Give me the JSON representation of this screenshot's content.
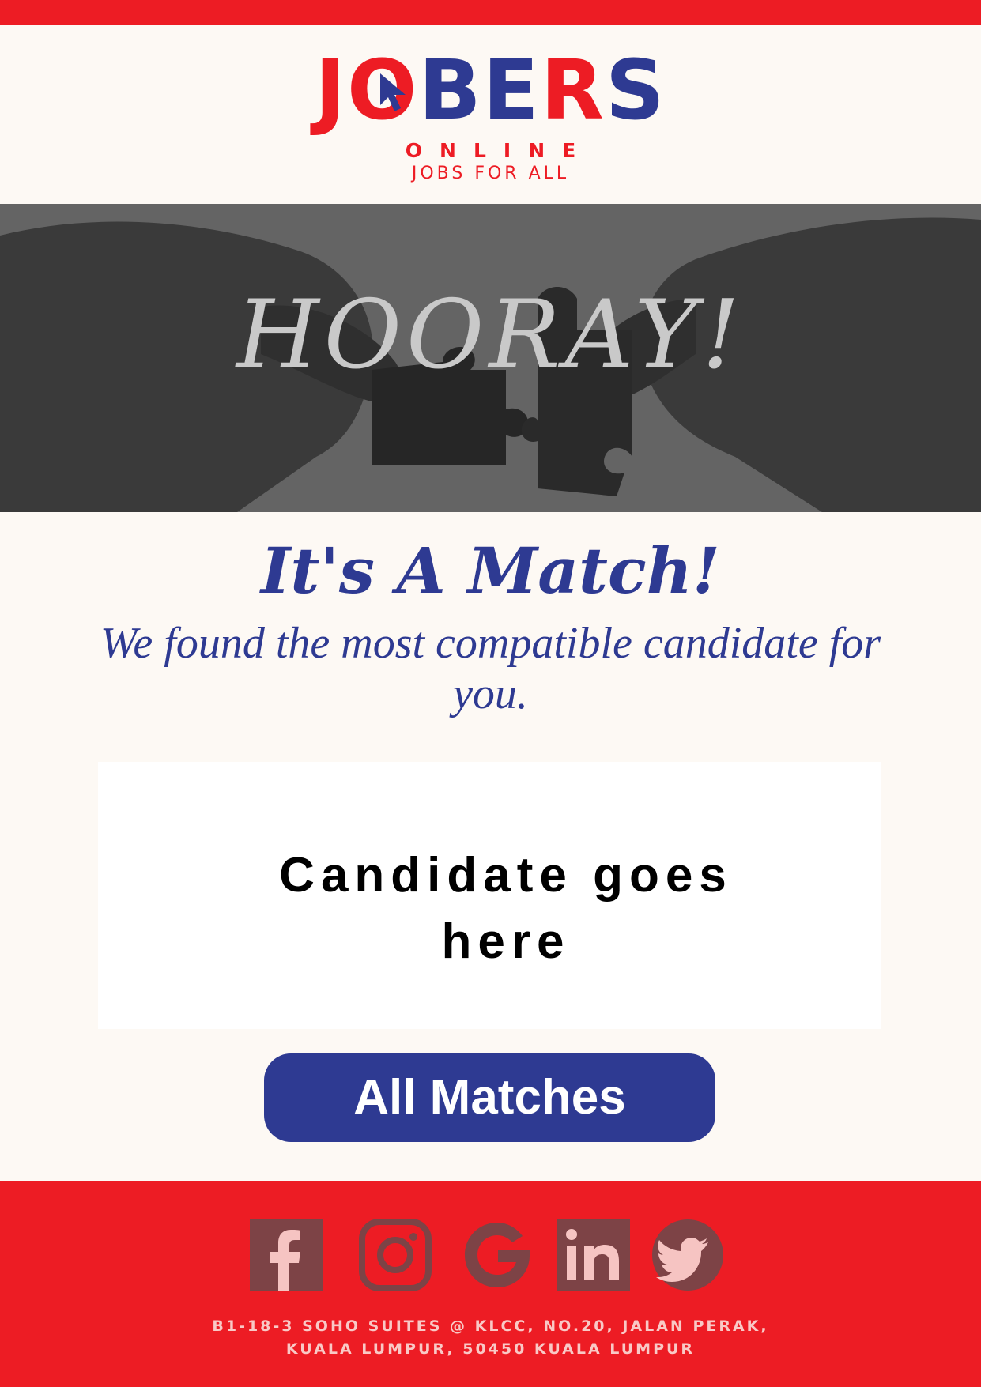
{
  "brand": {
    "logo_text": "JOBERS",
    "logo_sub": "ONLINE",
    "tagline": "JOBS FOR ALL",
    "accent_red": "#ed1c24",
    "accent_blue": "#2e3a92"
  },
  "hero": {
    "text": "HOORAY!",
    "image_subject": "hands-joining-puzzle-pieces"
  },
  "headline": "It's A Match!",
  "subline": "We found the most compatible candidate for you.",
  "candidate": {
    "placeholder_line1": "Candidate goes",
    "placeholder_line2": "here"
  },
  "cta": {
    "label": "All Matches"
  },
  "footer": {
    "social": [
      "facebook-icon",
      "instagram-icon",
      "google-icon",
      "linkedin-icon",
      "twitter-icon"
    ],
    "address_line1": "B1-18-3 SOHO SUITES @ KLCC, NO.20, JALAN PERAK,",
    "address_line2": "KUALA LUMPUR, 50450 KUALA LUMPUR"
  }
}
